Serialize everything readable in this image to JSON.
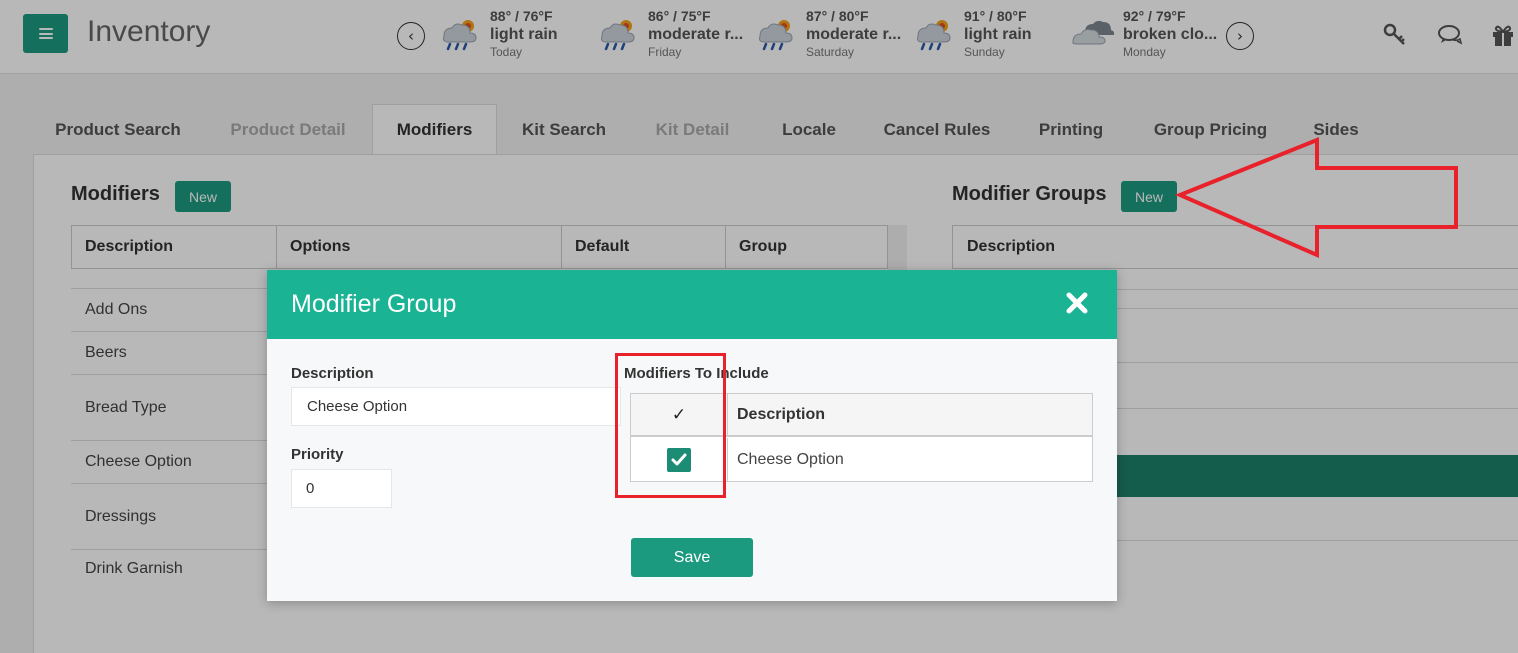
{
  "app": {
    "title": "Inventory"
  },
  "weather": [
    {
      "temp": "88° / 76°F",
      "condition": "light rain",
      "day": "Today",
      "icon": "rain-sun-icon"
    },
    {
      "temp": "86° / 75°F",
      "condition": "moderate r...",
      "day": "Friday",
      "icon": "rain-sun-icon"
    },
    {
      "temp": "87° / 80°F",
      "condition": "moderate r...",
      "day": "Saturday",
      "icon": "rain-sun-icon"
    },
    {
      "temp": "91° / 80°F",
      "condition": "light rain",
      "day": "Sunday",
      "icon": "rain-sun-icon"
    },
    {
      "temp": "92° / 79°F",
      "condition": "broken clo...",
      "day": "Monday",
      "icon": "broken-clouds-icon"
    }
  ],
  "tabs": [
    {
      "label": "Product Search",
      "state": "normal"
    },
    {
      "label": "Product Detail",
      "state": "disabled"
    },
    {
      "label": "Modifiers",
      "state": "active"
    },
    {
      "label": "Kit Search",
      "state": "normal"
    },
    {
      "label": "Kit Detail",
      "state": "disabled"
    },
    {
      "label": "Locale",
      "state": "normal"
    },
    {
      "label": "Cancel Rules",
      "state": "normal"
    },
    {
      "label": "Printing",
      "state": "normal"
    },
    {
      "label": "Group Pricing",
      "state": "normal"
    },
    {
      "label": "Sides",
      "state": "normal"
    }
  ],
  "modifiers": {
    "title": "Modifiers",
    "new_label": "New",
    "columns": [
      "Description",
      "Options",
      "Default",
      "Group"
    ],
    "rows": [
      "Add Ons",
      "Beers",
      "Bread Type",
      "Cheese Option",
      "Dressings",
      "Drink Garnish"
    ]
  },
  "modifier_groups": {
    "title": "Modifier Groups",
    "new_label": "New",
    "columns": [
      "Description"
    ]
  },
  "modal": {
    "title": "Modifier Group",
    "description_label": "Description",
    "description_value": "Cheese Option",
    "priority_label": "Priority",
    "priority_value": "0",
    "include_label": "Modifiers To Include",
    "include_check_header": "✓",
    "include_desc_header": "Description",
    "include_rows": [
      {
        "checked": true,
        "description": "Cheese Option"
      }
    ],
    "save_label": "Save"
  },
  "colors": {
    "brand": "#1c9a80",
    "modal_header": "#1ab394",
    "annotation": "#e8212b"
  }
}
